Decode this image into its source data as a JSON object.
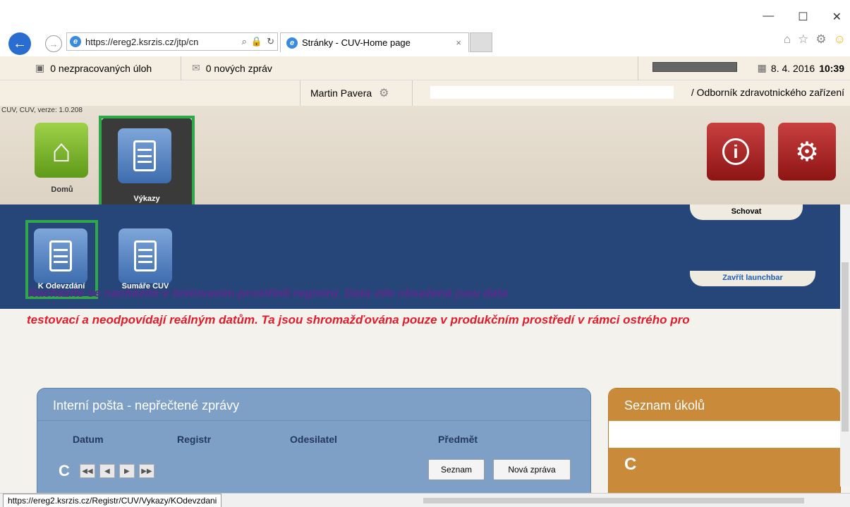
{
  "browser": {
    "url": "https://ereg2.ksrzis.cz/jtp/cn",
    "tab_title": "Stránky - CUV-Home page",
    "tab_close": "×",
    "minimize": "—",
    "maximize": "☐",
    "close": "✕"
  },
  "topbar": {
    "tasks": "0 nezpracovaných úloh",
    "messages": "0 nových zpráv",
    "date": "8. 4. 2016",
    "time": "10:39"
  },
  "userbar": {
    "user": "Martin Pavera",
    "role": "/ Odborník zdravotnického zařízení"
  },
  "launchbar": {
    "version": "CUV, CUV, verze: 1.0.208",
    "tiles": [
      {
        "label": "Domů"
      },
      {
        "label": "Výkazy"
      }
    ],
    "hide": "Schovat",
    "close_launchbar": "Zavřít launchbar"
  },
  "subnav": {
    "tiles": [
      {
        "label": "K Odevzdání"
      },
      {
        "label": "Sumáře CUV"
      }
    ]
  },
  "warning": {
    "line1": "Nacházíte se nacházíte  v testovacím prostředí registru. Data zde obsažená jsou data",
    "line2": "testovací a neodpovídají reálným datům. Ta jsou shromažďována pouze v produkčním prostředí v rámci ostrého pro"
  },
  "mail_panel": {
    "title": "Interní pošta - nepřečtené zprávy",
    "columns": [
      "Datum",
      "Registr",
      "Odesilatel",
      "Předmět"
    ],
    "list_button": "Seznam",
    "new_button": "Nová zpráva"
  },
  "task_panel": {
    "title": "Seznam úkolů"
  },
  "status": {
    "url": "https://ereg2.ksrzis.cz/Registr/CUV/Vykazy/KOdevzdani"
  },
  "colors": {
    "nav_blue": "#26467a",
    "highlight_green": "#2fa84a",
    "warning_red": "#e01c2c",
    "task_orange": "#c98a3a"
  }
}
